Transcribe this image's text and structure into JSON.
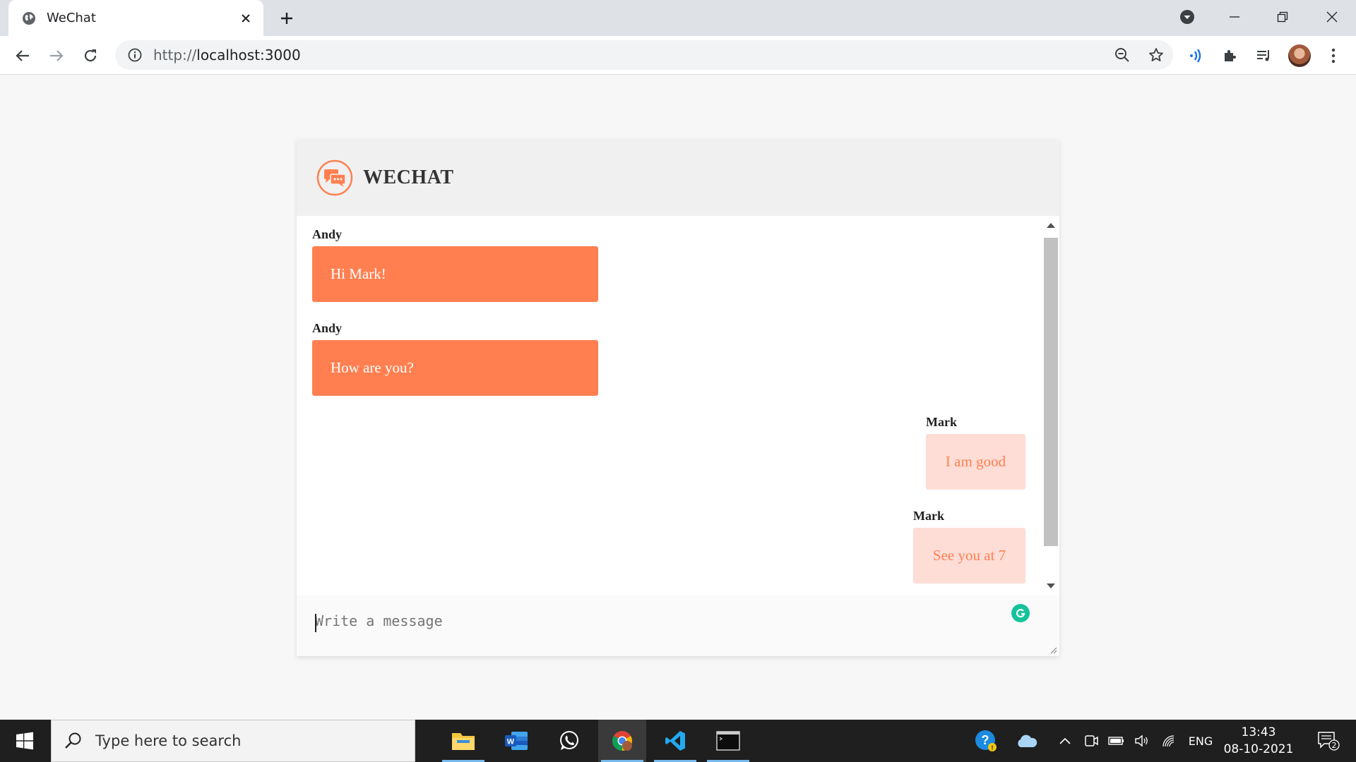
{
  "browser": {
    "tab_title": "WeChat",
    "url_scheme": "http://",
    "url_host": "localhost:3000"
  },
  "app": {
    "brand": "WECHAT",
    "accent_color": "#ff7f50",
    "outgoing_bubble_color": "#fdddd6"
  },
  "messages": [
    {
      "sender": "Andy",
      "text": "Hi Mark!",
      "direction": "incoming"
    },
    {
      "sender": "Andy",
      "text": "How are you?",
      "direction": "incoming"
    },
    {
      "sender": "Mark",
      "text": "I am good",
      "direction": "outgoing"
    },
    {
      "sender": "Mark",
      "text": "See you at 7",
      "direction": "outgoing"
    }
  ],
  "composer": {
    "placeholder": "Write a message",
    "value": ""
  },
  "taskbar": {
    "search_placeholder": "Type here to search",
    "language": "ENG",
    "time": "13:43",
    "date": "08-10-2021",
    "notification_count": "2"
  }
}
